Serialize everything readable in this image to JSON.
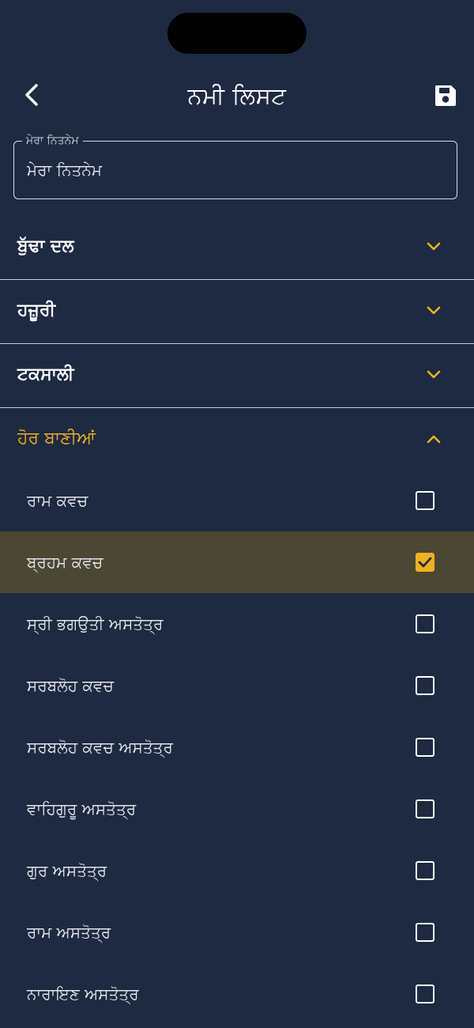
{
  "header": {
    "title": "ਨਮੀ ਲਿਸਟ",
    "back_icon": "chevron-left-icon",
    "save_icon": "floppy-disk-icon"
  },
  "name_field": {
    "label": "ਮੇਰਾ ਨਿਤਨੇਮ",
    "value": "ਮੇਰਾ ਨਿਤਨੇਮ"
  },
  "categories": [
    {
      "label": "ਬੁੱਢਾ ਦਲ",
      "expanded": false
    },
    {
      "label": "ਹਜ਼ੂਰੀ",
      "expanded": false
    },
    {
      "label": "ਟਕਸਾਲੀ",
      "expanded": false
    },
    {
      "label": "ਹੋਰ ਬਾਣੀਆਂ",
      "expanded": true
    }
  ],
  "banis": [
    {
      "label": "ਰਾਮ ਕਵਚ",
      "checked": false
    },
    {
      "label": "ਬ੍ਰਹਮ ਕਵਚ",
      "checked": true
    },
    {
      "label": "ਸ੍ਰੀ ਭਗਉਤੀ ਅਸਤੋਤ੍ਰ",
      "checked": false
    },
    {
      "label": "ਸਰਬਲੋਹ ਕਵਚ",
      "checked": false
    },
    {
      "label": "ਸਰਬਲੋਹ ਕਵਚ ਅਸਤੋਤ੍ਰ",
      "checked": false
    },
    {
      "label": "ਵਾਹਿਗੁਰੂ ਅਸਤੋਤ੍ਰ",
      "checked": false
    },
    {
      "label": "ਗੁਰ ਅਸਤੋਤ੍ਰ",
      "checked": false
    },
    {
      "label": "ਰਾਮ ਅਸਤੋਤ੍ਰ",
      "checked": false
    },
    {
      "label": "ਨਾਰਾਇਣ ਅਸਤੋਤ੍ਰ",
      "checked": false
    }
  ],
  "colors": {
    "background": "#1e2a41",
    "accent": "#f0b21b",
    "selected_row": "#4b4734",
    "divider": "#c7ccd6",
    "text": "#ffffff"
  }
}
